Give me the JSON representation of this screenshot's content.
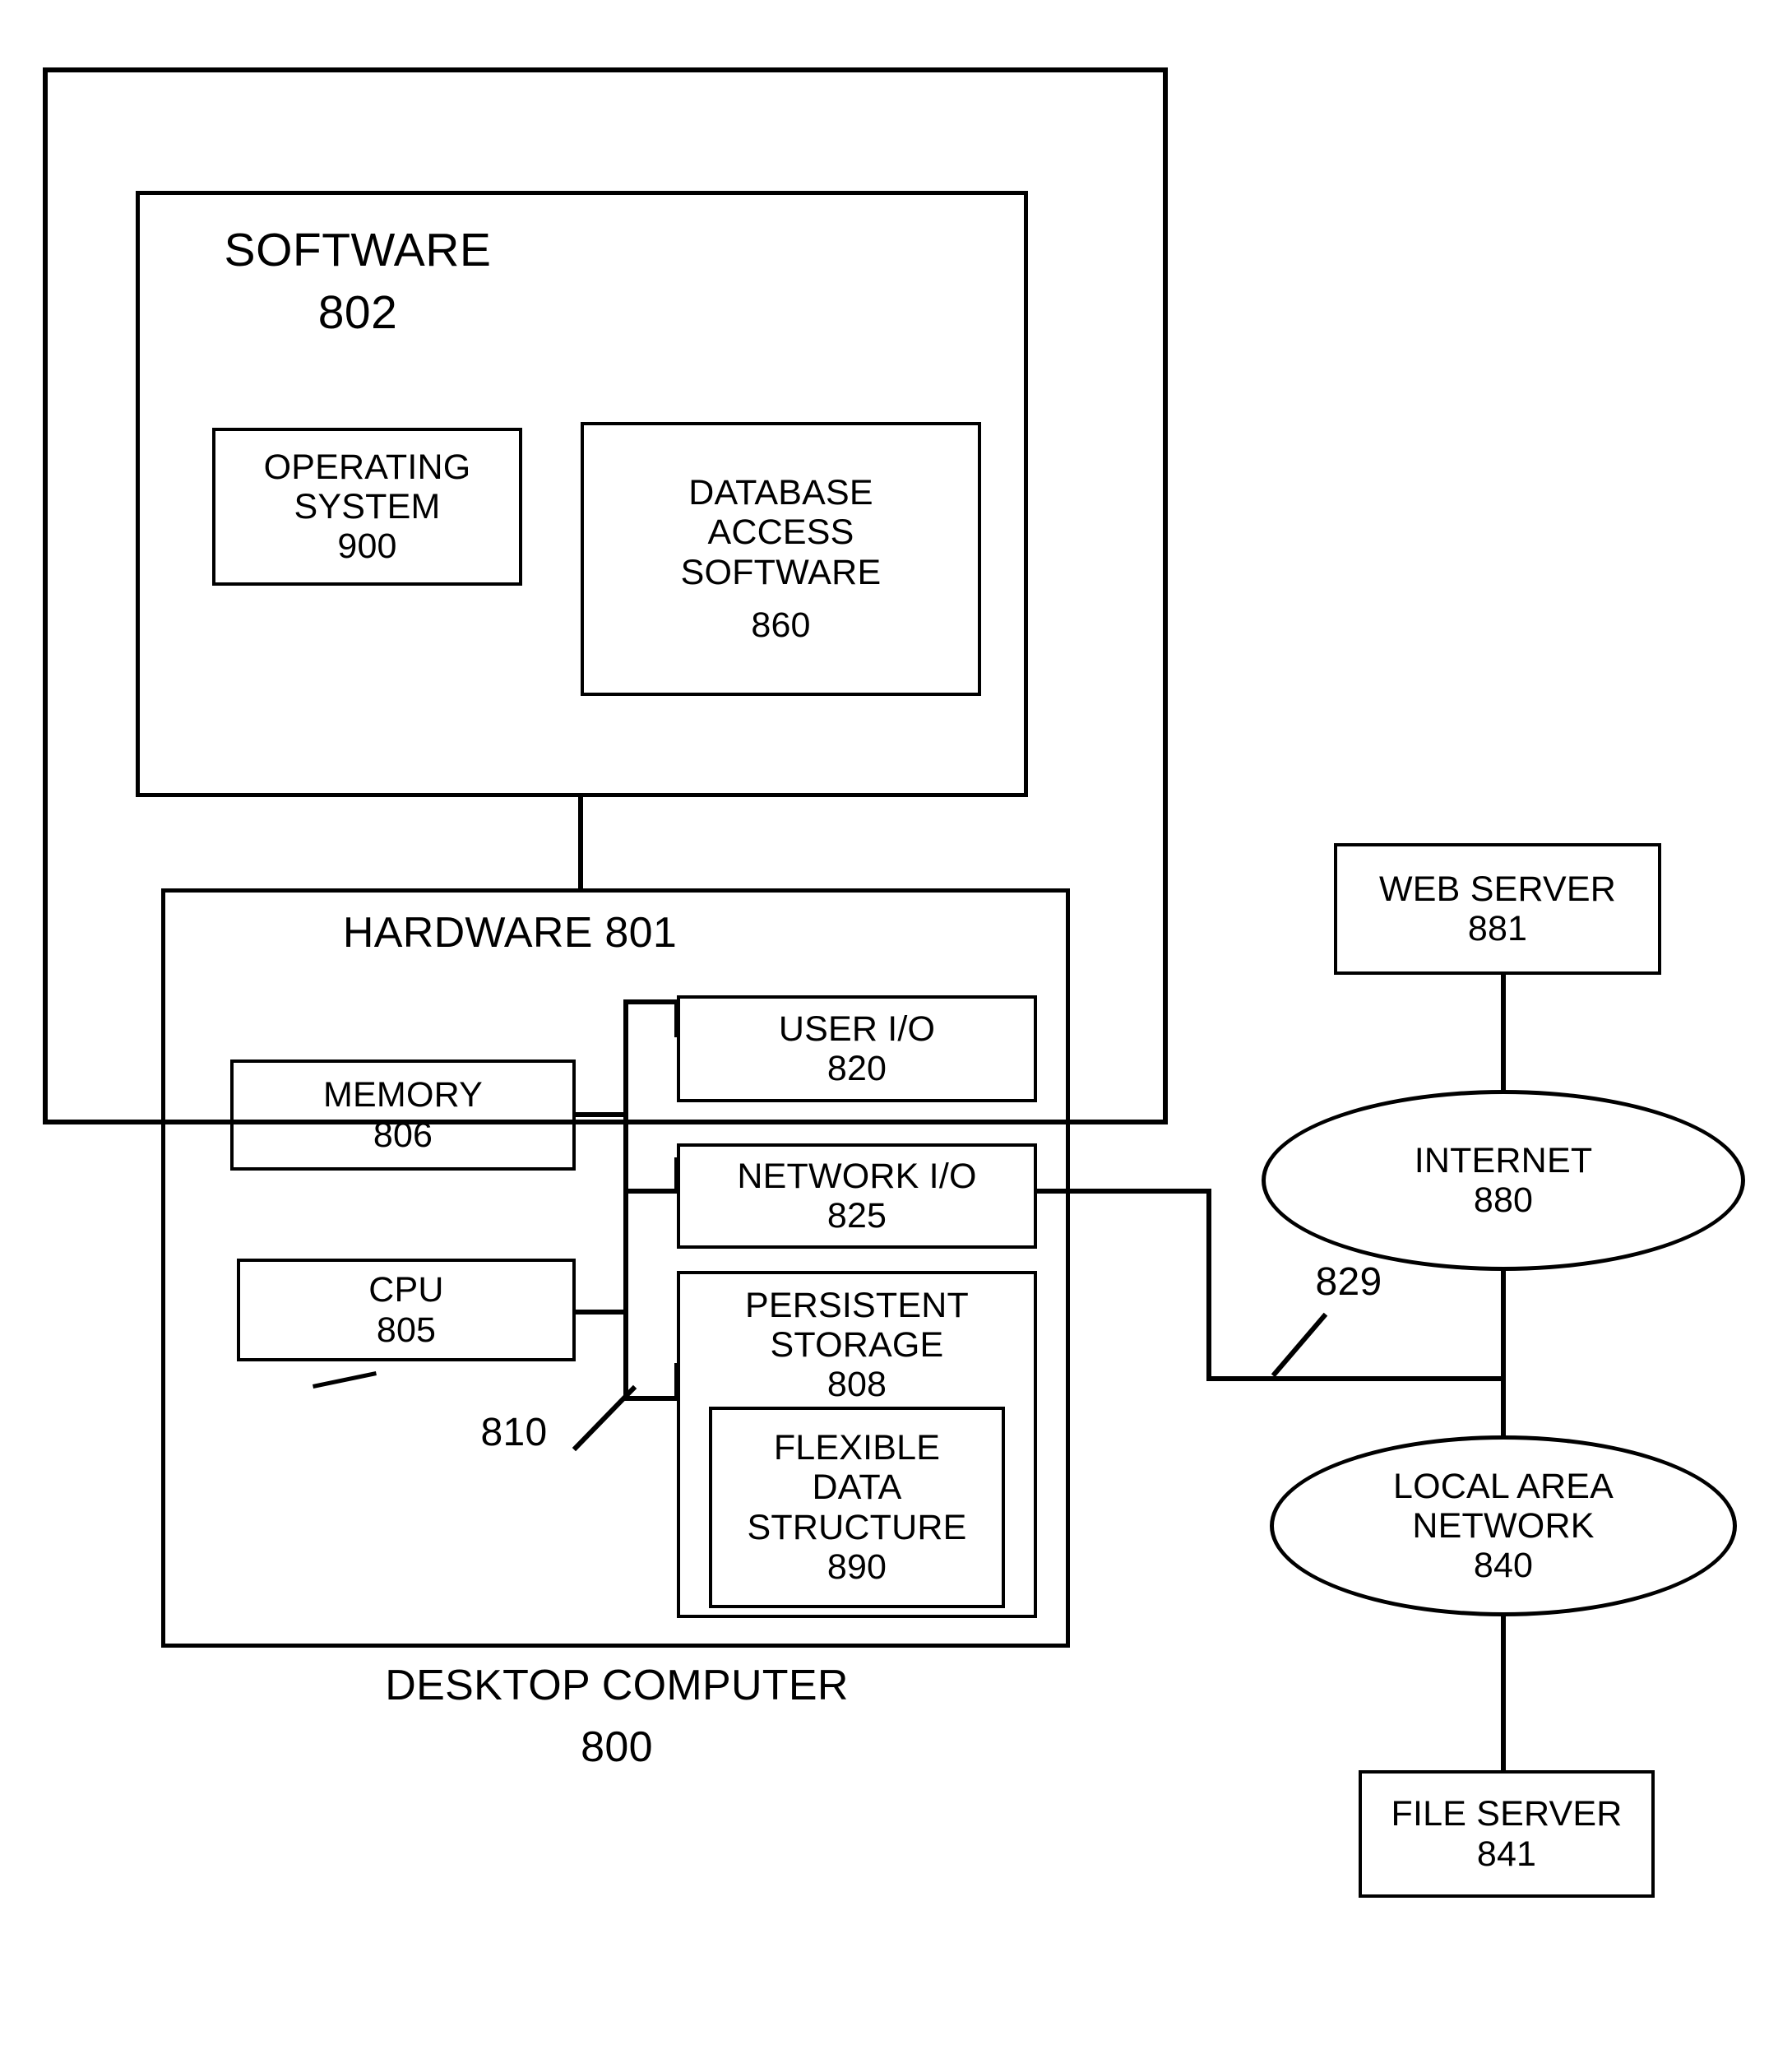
{
  "figure": {
    "outer_container": {
      "caption_line1": "DESKTOP COMPUTER",
      "caption_line2": "800"
    },
    "software": {
      "title_line1": "SOFTWARE",
      "title_line2": "802",
      "boxes": [
        {
          "name": "operating-system",
          "lines": [
            "OPERATING",
            "SYSTEM",
            "900"
          ]
        },
        {
          "name": "database-access-software",
          "lines": [
            "DATABASE",
            "ACCESS",
            "SOFTWARE",
            "860"
          ]
        }
      ]
    },
    "hardware": {
      "title": "HARDWARE 801",
      "bus_reference": "810",
      "boxes": [
        {
          "name": "memory",
          "lines": [
            "MEMORY",
            "806"
          ]
        },
        {
          "name": "cpu",
          "lines": [
            "CPU",
            "805"
          ]
        },
        {
          "name": "user-io",
          "lines": [
            "USER I/O",
            "820"
          ]
        },
        {
          "name": "network-io",
          "lines": [
            "NETWORK I/O",
            "825"
          ]
        },
        {
          "name": "persistent-storage",
          "lines": [
            "PERSISTENT",
            "STORAGE",
            "808"
          ]
        },
        {
          "name": "flexible-data-structure",
          "lines": [
            "FLEXIBLE",
            "DATA",
            "STRUCTURE",
            "890"
          ]
        }
      ]
    },
    "network": {
      "connection_reference": "829",
      "nodes": [
        {
          "name": "web-server",
          "shape": "rect",
          "lines": [
            "WEB SERVER",
            "881"
          ]
        },
        {
          "name": "internet",
          "shape": "ellipse",
          "lines": [
            "INTERNET",
            "880"
          ]
        },
        {
          "name": "local-area-network",
          "shape": "ellipse",
          "lines": [
            "LOCAL AREA",
            "NETWORK",
            "840"
          ]
        },
        {
          "name": "file-server",
          "shape": "rect",
          "lines": [
            "FILE SERVER",
            "841"
          ]
        }
      ]
    },
    "colors": {
      "ink": "#000000",
      "paper": "#ffffff"
    }
  }
}
